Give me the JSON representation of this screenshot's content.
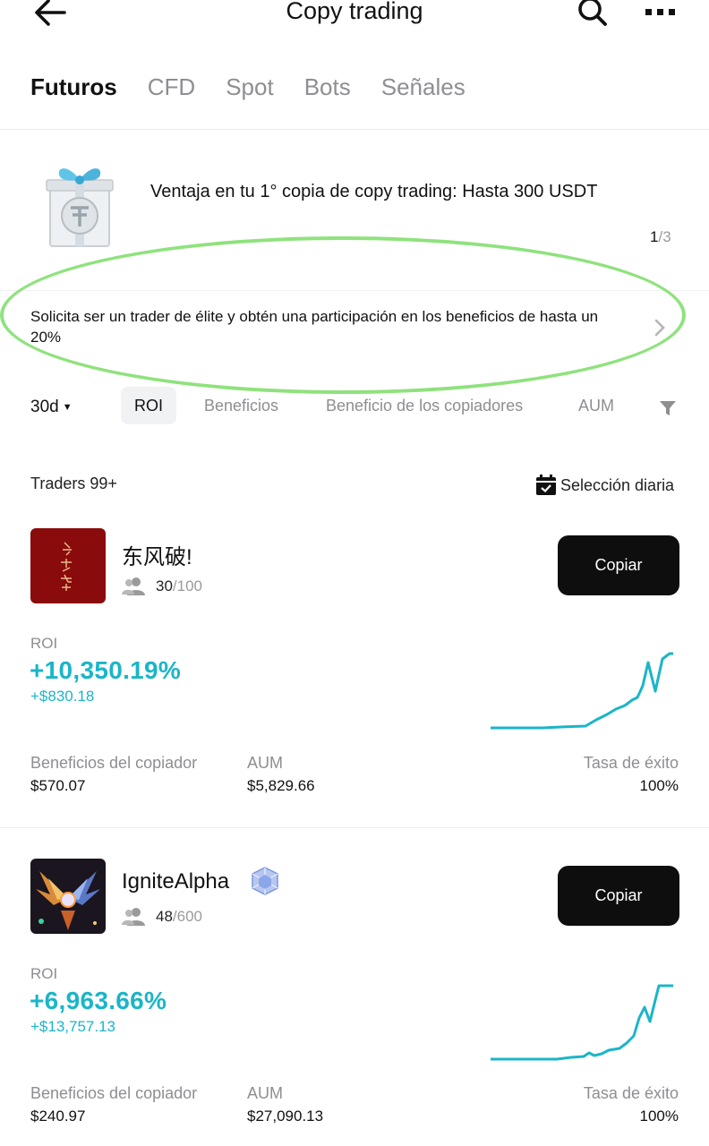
{
  "header": {
    "title": "Copy trading"
  },
  "tabs": [
    "Futuros",
    "CFD",
    "Spot",
    "Bots",
    "Señales"
  ],
  "promo": {
    "text": "Ventaja en tu 1° copia de copy trading: Hasta 300 USDT",
    "pager_current": "1",
    "pager_total": "/3"
  },
  "elite": {
    "text": "Solicita ser un trader de élite y obtén una participación en los beneficios de hasta un 20%"
  },
  "filters": {
    "period": "30d",
    "chips": [
      "ROI",
      "Beneficios",
      "Beneficio de los copiadores",
      "AUM"
    ]
  },
  "list": {
    "count": "Traders 99+",
    "daily": "Selección diaria"
  },
  "traders": [
    {
      "name": "东风破!",
      "copiers": "30",
      "copiers_max": "/100",
      "copy_label": "Copiar",
      "roi_label": "ROI",
      "roi": "+10,350.19%",
      "roi_amount": "+$830.18",
      "stat1_label": "Beneficios del copiador",
      "stat1_value": "$570.07",
      "stat2_label": "AUM",
      "stat2_value": "$5,829.66",
      "stat3_label": "Tasa de éxito",
      "stat3_value": "100%"
    },
    {
      "name": "IgniteAlpha",
      "copiers": "48",
      "copiers_max": "/600",
      "copy_label": "Copiar",
      "roi_label": "ROI",
      "roi": "+6,963.66%",
      "roi_amount": "+$13,757.13",
      "stat1_label": "Beneficios del copiador",
      "stat1_value": "$240.97",
      "stat2_label": "AUM",
      "stat2_value": "$27,090.13",
      "stat3_label": "Tasa de éxito",
      "stat3_value": "100%"
    }
  ],
  "colors": {
    "accent": "#1bb5c8",
    "highlight": "#8fe27d",
    "button": "#0e0e0e"
  }
}
